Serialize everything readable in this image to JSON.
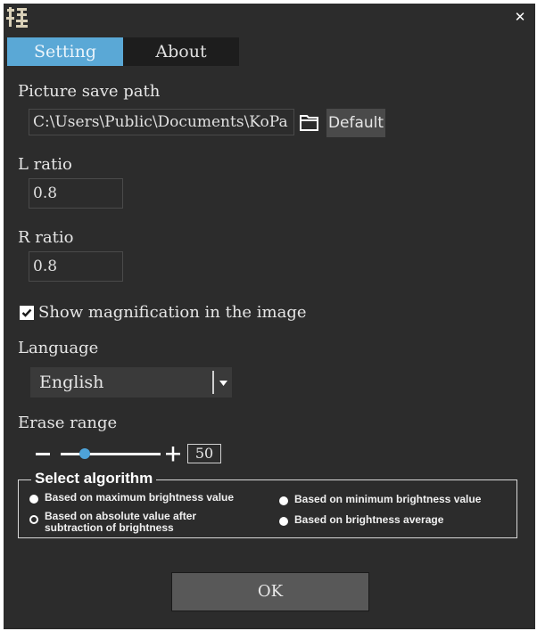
{
  "window": {
    "tabs": [
      {
        "label": "Setting",
        "active": true
      },
      {
        "label": "About",
        "active": false
      }
    ]
  },
  "settings": {
    "save_path_label": "Picture save path",
    "save_path_value": "C:\\Users\\Public\\Documents\\KoPa",
    "default_button": "Default",
    "l_ratio_label": "L ratio",
    "l_ratio_value": "0.8",
    "r_ratio_label": "R ratio",
    "r_ratio_value": "0.8",
    "show_magnification_label": "Show magnification in the image",
    "show_magnification_checked": true,
    "language_label": "Language",
    "language_value": "English",
    "erase_range_label": "Erase range",
    "erase_range_value": "50",
    "erase_range_slider_fraction": 0.24
  },
  "algorithm": {
    "title": "Select algorithm",
    "options": [
      {
        "label": "Based on maximum brightness value",
        "selected": false
      },
      {
        "label": "Based on minimum brightness value",
        "selected": false
      },
      {
        "label": "Based on absolute value after subtraction of brightness",
        "selected": true
      },
      {
        "label": "Based on brightness average",
        "selected": false
      }
    ]
  },
  "footer": {
    "ok_button": "OK"
  },
  "colors": {
    "background": "#2c2c2c",
    "active_tab": "#5aa8d6",
    "slider_thumb": "#4ea3d8"
  },
  "icons": [
    "app-icon",
    "close-icon",
    "folder-icon",
    "dropdown-arrow-icon",
    "minus-icon",
    "plus-icon",
    "checkmark-icon"
  ]
}
